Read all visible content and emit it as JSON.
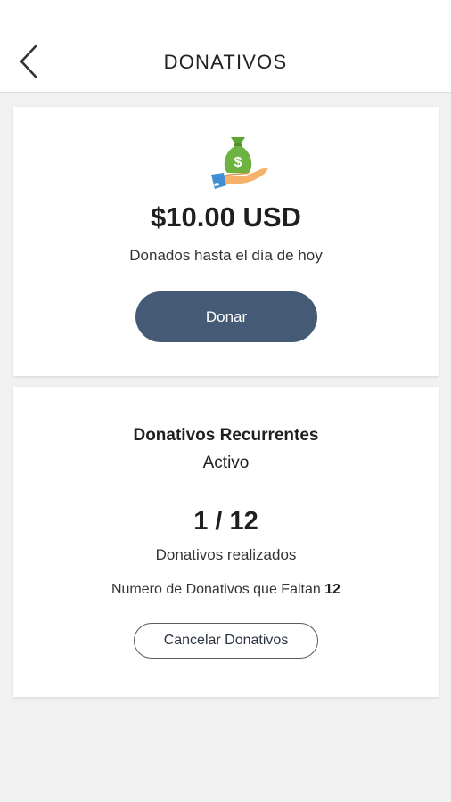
{
  "header": {
    "title": "DONATIVOS",
    "back_icon": "chevron-left-icon"
  },
  "donation_card": {
    "icon": "money-bag-hand-icon",
    "amount": "$10.00 USD",
    "amount_caption": "Donados hasta el día de hoy",
    "donate_label": "Donar"
  },
  "recurring_card": {
    "title": "Donativos Recurrentes",
    "status": "Activo",
    "count": "1 / 12",
    "count_caption": "Donativos realizados",
    "remaining_label": "Numero de Donativos que Faltan",
    "remaining_value": "12",
    "cancel_label": "Cancelar Donativos"
  },
  "colors": {
    "primary_button": "#455a74",
    "background": "#f2f1f2",
    "money_bag": "#6cb33f",
    "hand": "#f7b26a",
    "sleeve": "#3f8fd2"
  }
}
